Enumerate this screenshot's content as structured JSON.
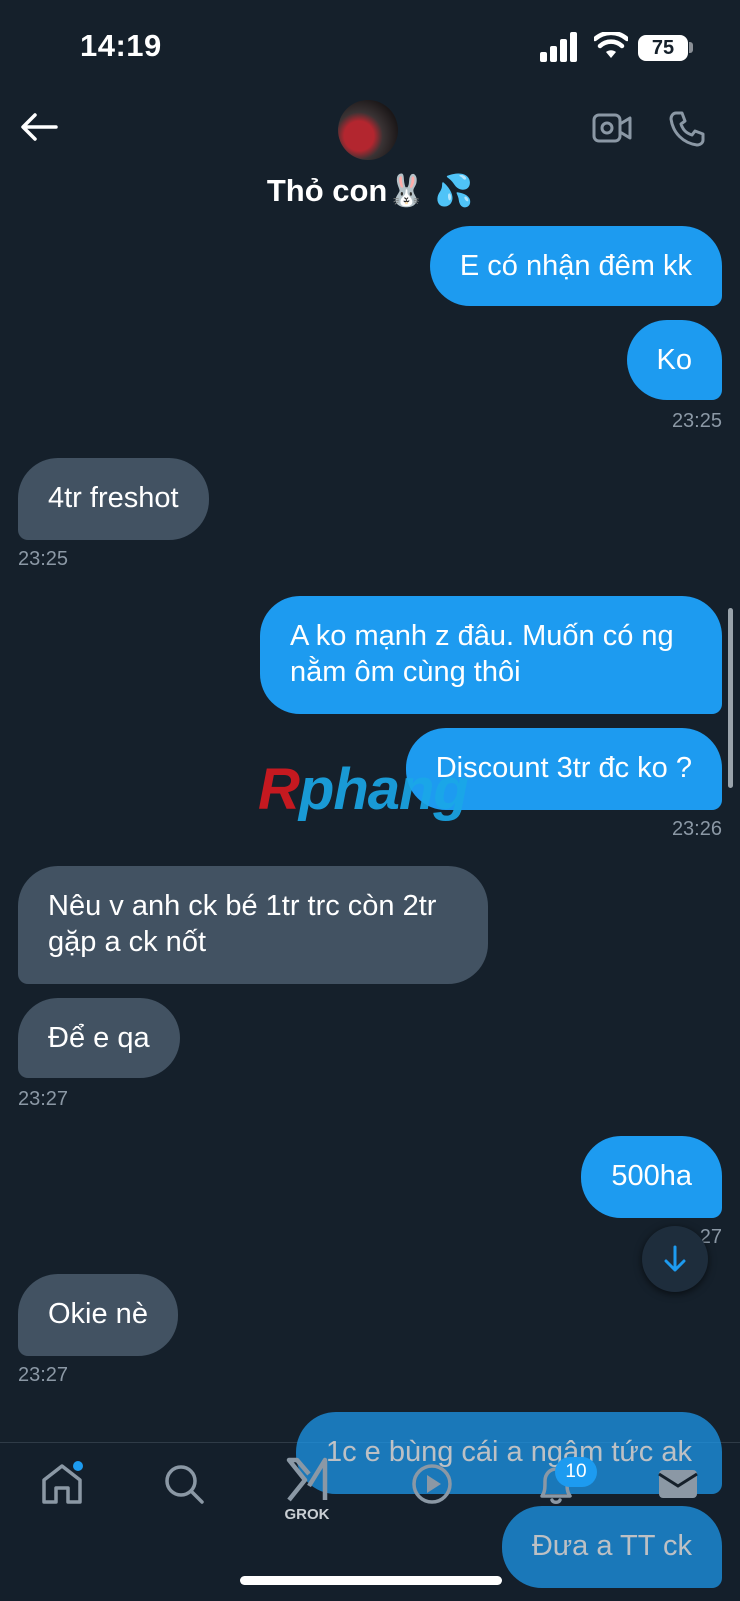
{
  "status": {
    "time": "14:19",
    "battery": "75"
  },
  "header": {
    "contact_name": "Thỏ con🐰 💦"
  },
  "messages": [
    {
      "dir": "sent",
      "text": "E có nhận đêm kk"
    },
    {
      "dir": "sent",
      "text": "Ko",
      "time": "23:25"
    },
    {
      "dir": "recv",
      "text": "4tr freshot",
      "time": "23:25"
    },
    {
      "dir": "sent",
      "text": "A ko mạnh z đâu. Muốn có ng nằm ôm cùng thôi"
    },
    {
      "dir": "sent",
      "text": "Discount 3tr đc ko ?",
      "time": "23:26"
    },
    {
      "dir": "recv",
      "text": "Nêu v anh ck bé 1tr trc còn 2tr gặp a ck nốt"
    },
    {
      "dir": "recv",
      "text": "Để e qa",
      "time": "23:27"
    },
    {
      "dir": "sent",
      "text": "500ha",
      "time": "27"
    },
    {
      "dir": "recv",
      "text": "Okie nè",
      "time": "23:27"
    },
    {
      "dir": "sent",
      "text": "1c e bùng cái a ngậm tức ak"
    },
    {
      "dir": "sent",
      "text": "Đưa a TT ck"
    }
  ],
  "watermark": {
    "first": "R",
    "rest": "phang"
  },
  "tabbar": {
    "grok_label": "GROK",
    "notifications_count": "10"
  },
  "colors": {
    "background": "#15202b",
    "sent_bubble": "#1d9bf0",
    "received_bubble": "#425262",
    "accent": "#1d9bf0"
  },
  "icons": [
    "back-arrow-icon",
    "video-call-icon",
    "phone-call-icon",
    "home-icon",
    "search-icon",
    "grok-icon",
    "play-icon",
    "bell-icon",
    "mail-icon",
    "arrow-down-icon"
  ]
}
